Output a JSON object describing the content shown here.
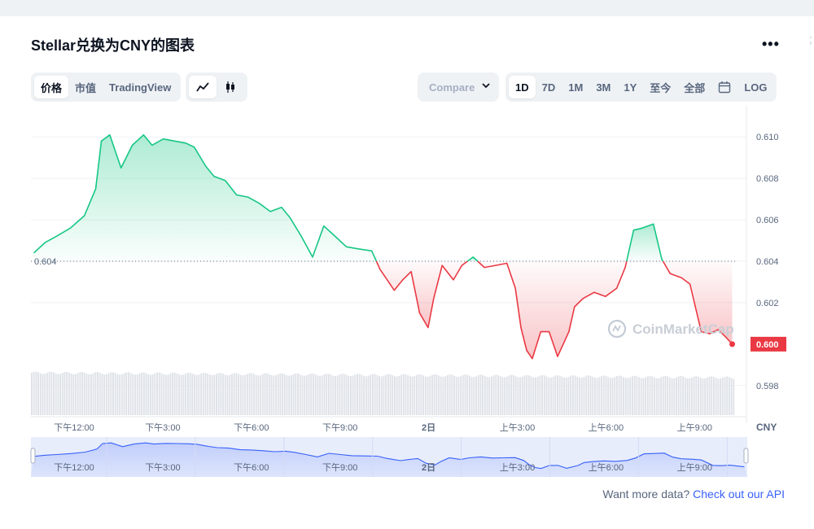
{
  "title": "Stellar兑换为CNY的图表",
  "toolbar": {
    "view_tabs": [
      "价格",
      "市值",
      "TradingView"
    ],
    "type_icons": [
      "line-chart-icon",
      "candlestick-icon"
    ],
    "compare_placeholder": "Compare",
    "ranges": [
      "1D",
      "7D",
      "1M",
      "3M",
      "1Y",
      "至今",
      "全部"
    ],
    "calendar_icon": "calendar-icon",
    "log_label": "LOG"
  },
  "footer": {
    "text": "Want more data?",
    "link_text": "Check out our API"
  },
  "watermark": "CoinMarketCap",
  "colors": {
    "up": "#16c784",
    "down": "#ea3943",
    "accent": "#3861fb"
  },
  "chart_data": {
    "type": "line",
    "currency": "CNY",
    "baseline": 0.604,
    "baseline_label": "0.604",
    "current_price": 0.6,
    "current_label": "0.600",
    "yticks": [
      "0.610",
      "0.608",
      "0.606",
      "0.604",
      "0.602",
      "0.598"
    ],
    "ylim": [
      0.5965,
      0.6115
    ],
    "xticks": [
      "下午12:00",
      "下午3:00",
      "下午6:00",
      "下午9:00",
      "2日",
      "上午3:00",
      "上午6:00",
      "上午9:00"
    ],
    "xticks_hours": [
      12,
      15,
      18,
      21,
      24,
      27,
      30,
      33
    ],
    "x_hours": [
      10.6,
      11.0,
      11.4,
      11.9,
      12.4,
      12.8,
      13.0,
      13.3,
      13.7,
      14.1,
      14.5,
      14.8,
      15.2,
      15.6,
      16.0,
      16.3,
      16.7,
      17.0,
      17.4,
      17.8,
      18.2,
      18.6,
      19.0,
      19.4,
      19.7,
      20.1,
      20.5,
      20.9,
      21.3,
      21.7,
      22.1,
      22.6,
      22.9,
      23.1,
      23.4,
      23.7,
      24.0,
      24.3,
      24.6,
      24.8,
      25.1,
      25.5,
      25.8,
      26.2,
      26.6,
      27.0,
      27.4,
      27.7,
      27.9,
      28.1,
      28.3,
      28.6,
      28.9,
      29.2,
      29.6,
      29.8,
      30.1,
      30.5,
      30.9,
      31.3,
      31.6,
      31.9,
      32.2,
      32.6,
      32.9,
      33.2,
      33.6,
      33.9,
      34.3,
      34.6,
      34.9,
      35.2,
      35.4
    ],
    "price": [
      0.6044,
      0.6049,
      0.6052,
      0.6056,
      0.6062,
      0.6075,
      0.6098,
      0.6101,
      0.6085,
      0.6096,
      0.6101,
      0.6096,
      0.6099,
      0.6098,
      0.6097,
      0.6095,
      0.6086,
      0.6081,
      0.6079,
      0.6072,
      0.6071,
      0.6068,
      0.6064,
      0.6066,
      0.6061,
      0.6052,
      0.6042,
      0.6057,
      0.6052,
      0.6047,
      0.6046,
      0.6045,
      0.6036,
      0.6032,
      0.6026,
      0.6031,
      0.6035,
      0.6015,
      0.6008,
      0.6022,
      0.6038,
      0.6031,
      0.6038,
      0.6042,
      0.6037,
      0.6038,
      0.6039,
      0.6027,
      0.6008,
      0.5997,
      0.5993,
      0.6006,
      0.6006,
      0.5994,
      0.6006,
      0.6018,
      0.6022,
      0.6025,
      0.6023,
      0.6027,
      0.6037,
      0.6055,
      0.6056,
      0.6058,
      0.6041,
      0.6034,
      0.6032,
      0.6029,
      0.6006,
      0.6005,
      0.6007,
      0.6003,
      0.6
    ],
    "volume_bars": 320
  }
}
